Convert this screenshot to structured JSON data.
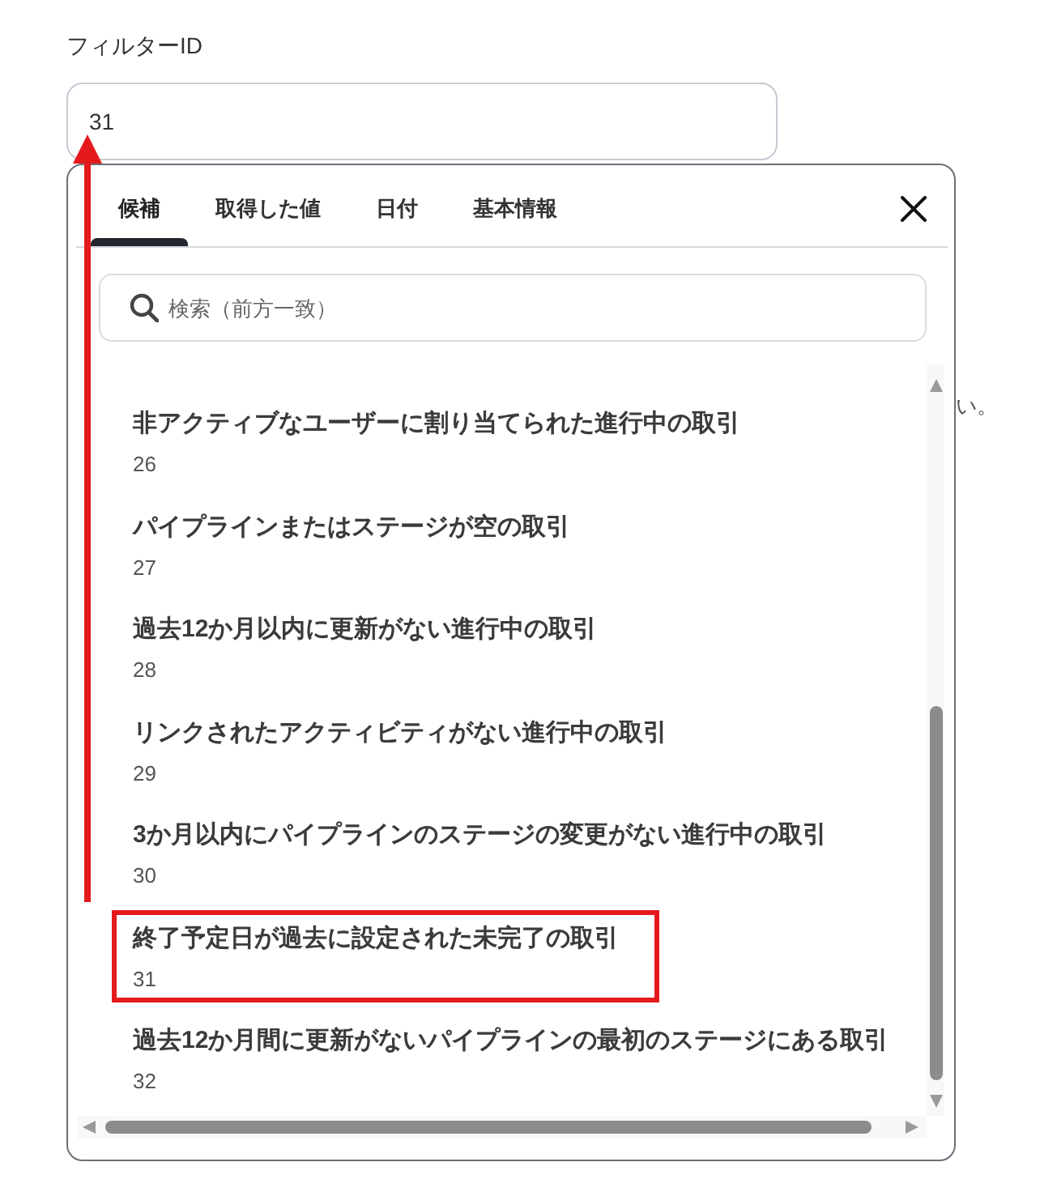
{
  "field": {
    "label": "フィルターID",
    "value": "31"
  },
  "picker": {
    "tabs": [
      {
        "label": "候補",
        "selected": true
      },
      {
        "label": "取得した値",
        "selected": false
      },
      {
        "label": "日付",
        "selected": false
      },
      {
        "label": "基本情報",
        "selected": false
      }
    ],
    "search": {
      "placeholder": "検索（前方一致）"
    },
    "options": [
      {
        "title": "非アクティブなユーザーに割り当てられた進行中の取引",
        "id": "26",
        "highlighted": false
      },
      {
        "title": "パイプラインまたはステージが空の取引",
        "id": "27",
        "highlighted": false
      },
      {
        "title": "過去12か月以内に更新がない進行中の取引",
        "id": "28",
        "highlighted": false
      },
      {
        "title": "リンクされたアクティビティがない進行中の取引",
        "id": "29",
        "highlighted": false
      },
      {
        "title": "3か月以内にパイプラインのステージの変更がない進行中の取引",
        "id": "30",
        "highlighted": false
      },
      {
        "title": "終了予定日が過去に設定された未完了の取引",
        "id": "31",
        "highlighted": true
      },
      {
        "title": "過去12か月間に更新がないパイプラインの最初のステージにある取引",
        "id": "32",
        "highlighted": false
      }
    ]
  },
  "background_text": "い。"
}
